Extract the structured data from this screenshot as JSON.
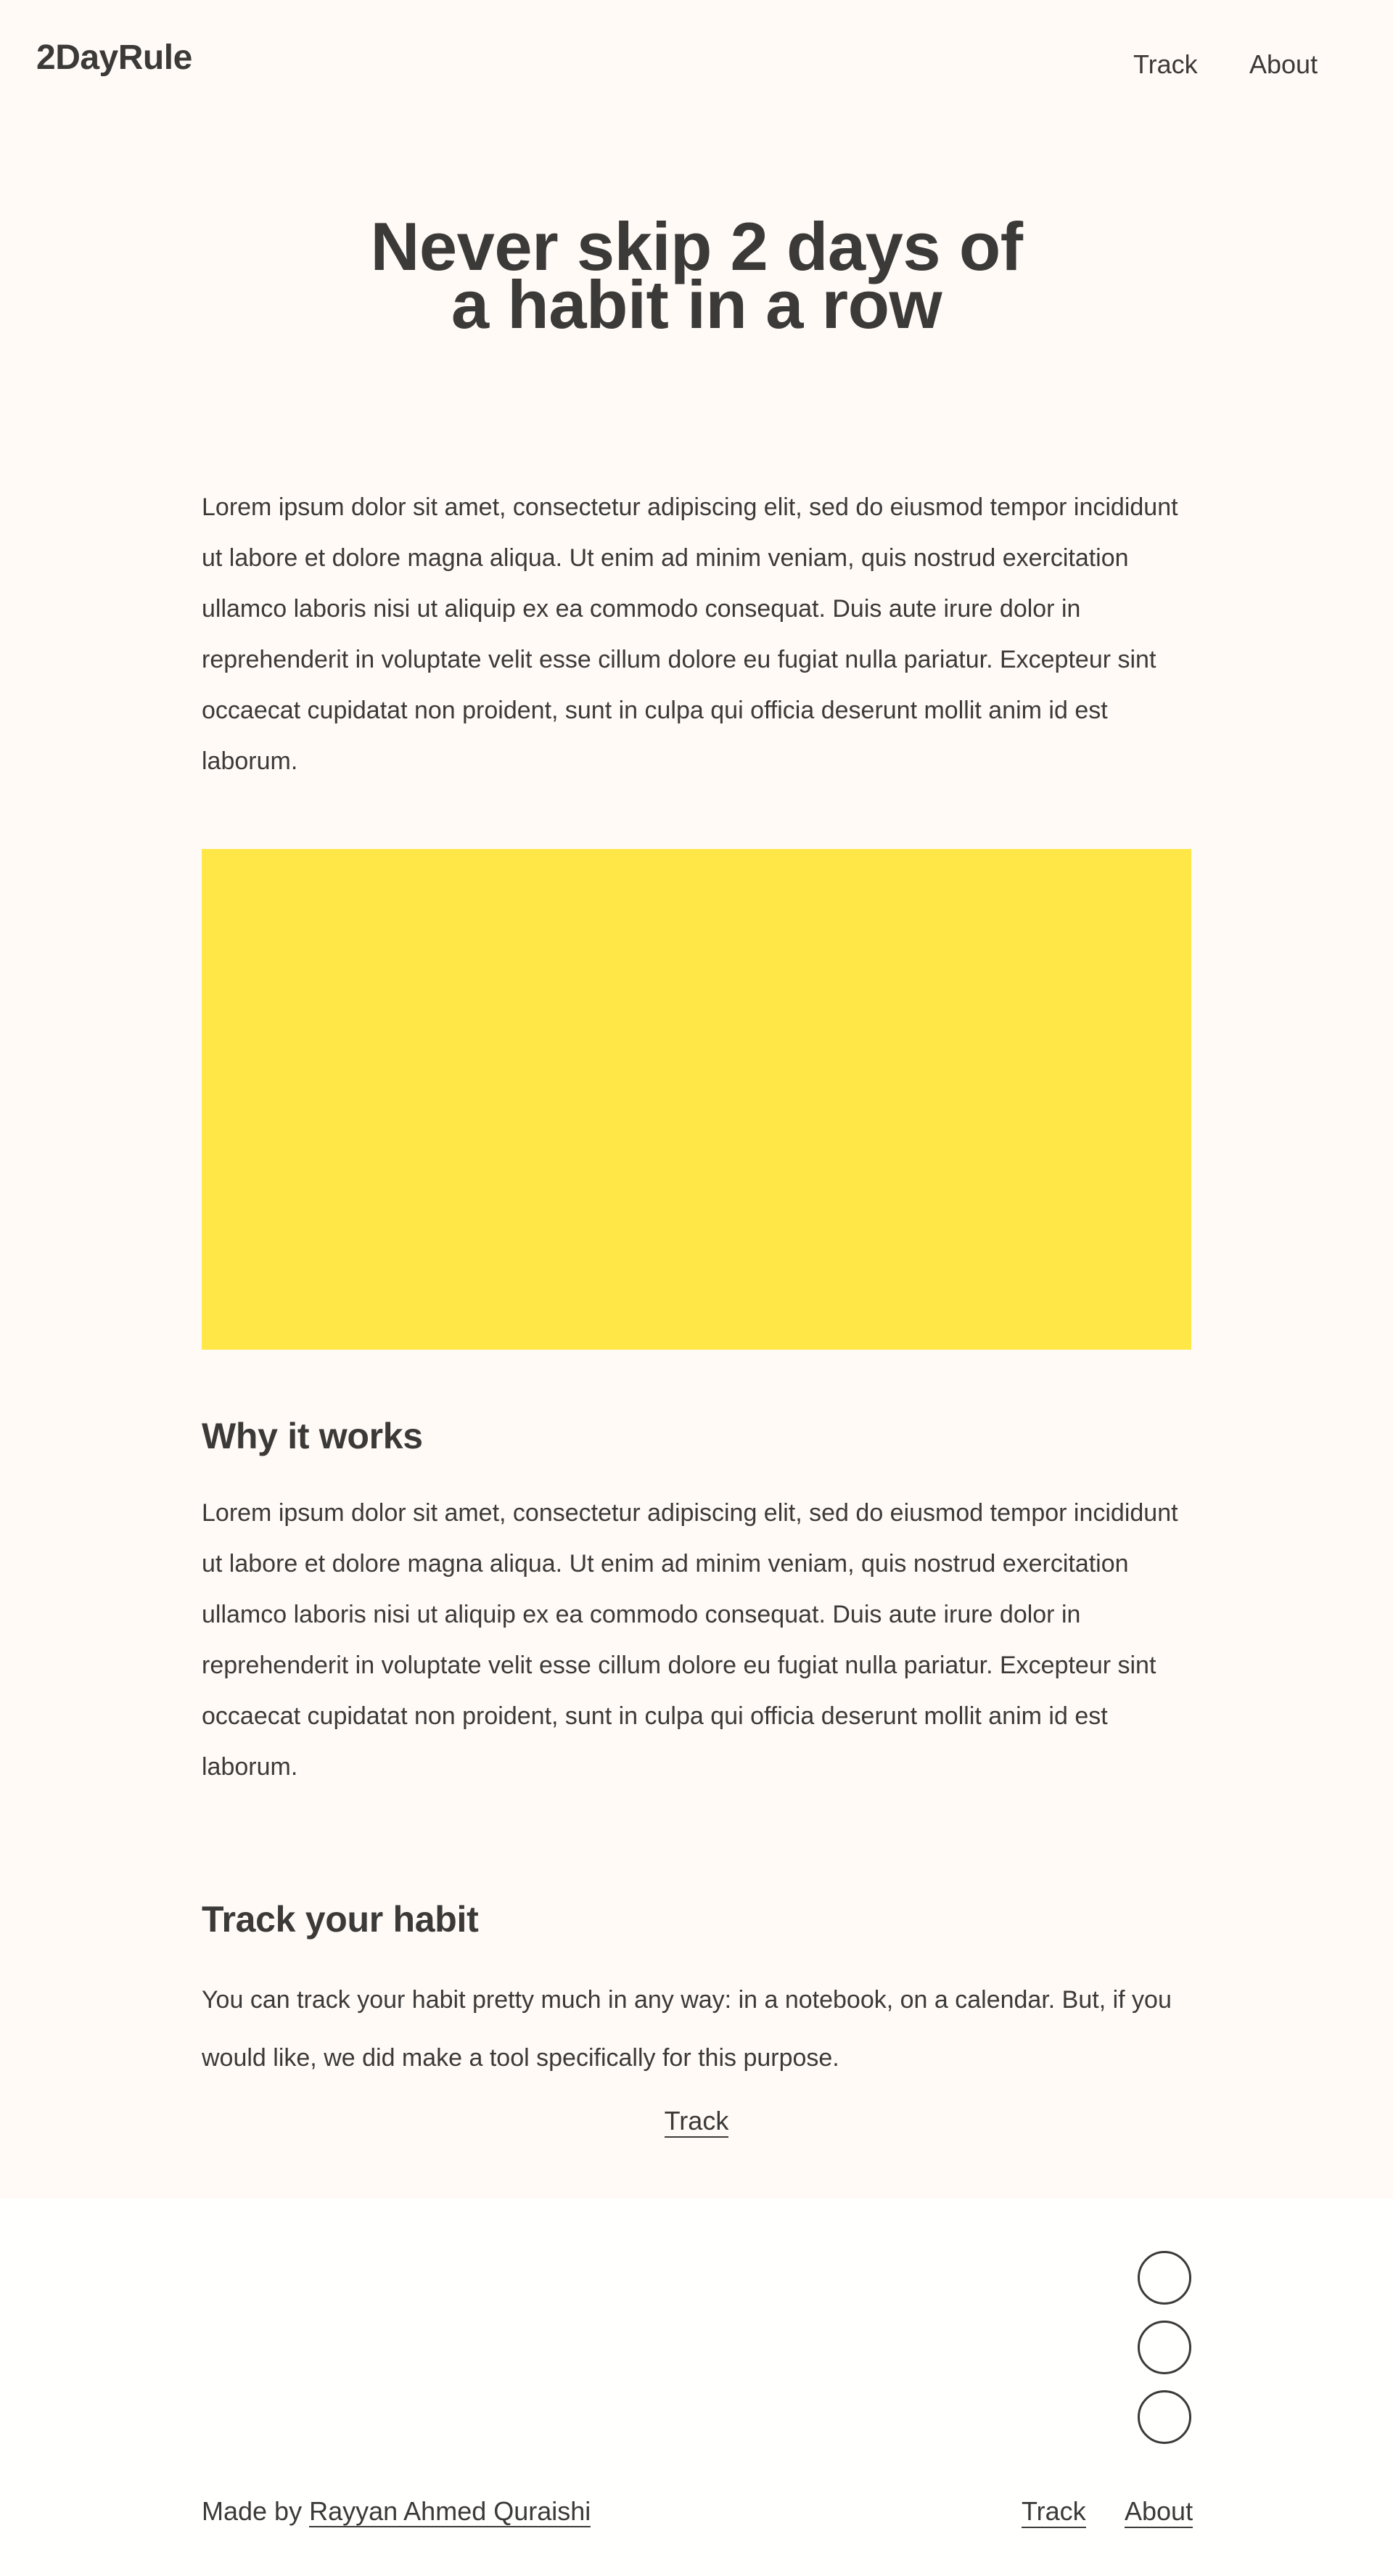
{
  "header": {
    "logo": "2DayRule",
    "nav": {
      "track": "Track",
      "about": "About"
    }
  },
  "hero": {
    "title_line1": "Never skip 2 days of",
    "title_line2": "a habit in a row"
  },
  "intro": {
    "text": "Lorem ipsum dolor sit amet, consectetur adipiscing elit, sed do eiusmod tempor incididunt ut labore et dolore magna aliqua. Ut enim ad minim veniam, quis nostrud exercitation ullamco laboris nisi ut aliquip ex ea commodo consequat. Duis aute irure dolor in reprehenderit in voluptate velit esse cillum dolore eu fugiat nulla pariatur. Excepteur sint occaecat cupidatat non proident, sunt in culpa qui officia deserunt mollit anim id est laborum."
  },
  "image_placeholder": {
    "color": "#ffe747"
  },
  "why": {
    "title": "Why it works",
    "text": "Lorem ipsum dolor sit amet, consectetur adipiscing elit, sed do eiusmod tempor incididunt ut labore et dolore magna aliqua. Ut enim ad minim veniam, quis nostrud exercitation ullamco laboris nisi ut aliquip ex ea commodo consequat. Duis aute irure dolor in reprehenderit in voluptate velit esse cillum dolore eu fugiat nulla pariatur. Excepteur sint occaecat cupidatat non proident, sunt in culpa qui officia deserunt mollit anim id est laborum."
  },
  "track_section": {
    "title": "Track your habit",
    "text": "You can track your habit pretty much in any way: in a notebook, on a calendar. But, if you would like, we did make a tool specifically for this purpose.",
    "link": "Track"
  },
  "footer": {
    "made_by_prefix": "Made by",
    "author": "Rayyan Ahmed Quraishi",
    "links": {
      "track": "Track",
      "about": "About"
    }
  },
  "colors": {
    "background": "#fffaf6",
    "footer_background": "#fffffe",
    "text": "#3b3a38",
    "accent": "#ffe747"
  }
}
